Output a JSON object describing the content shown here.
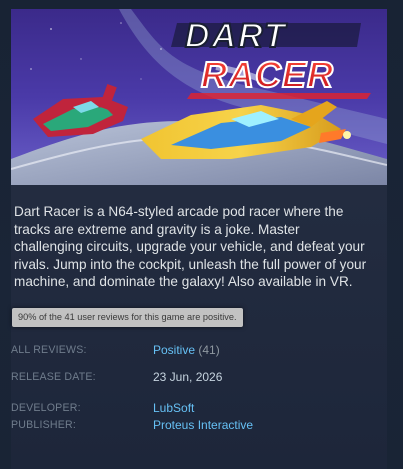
{
  "capsule": {
    "logo_word1": "DART",
    "logo_word2": "RACER",
    "alt": "Dart Racer header image"
  },
  "description": "Dart Racer is a N64-styled arcade pod racer where the tracks are extreme and gravity is a joke. Master challenging circuits, upgrade your vehicle, and defeat your rivals. Jump into the cockpit, unleash the full power of your machine, and dominate the galaxy! Also available in VR.",
  "tooltip": "90% of the 41 user reviews for this game are positive.",
  "info": {
    "reviews_label": "ALL REVIEWS:",
    "reviews_summary": "Positive",
    "reviews_count": "(41)",
    "release_label": "RELEASE DATE:",
    "release_date": "23 Jun, 2026",
    "developer_label": "DEVELOPER:",
    "developer": "LubSoft",
    "publisher_label": "PUBLISHER:",
    "publisher": "Proteus Interactive"
  },
  "colors": {
    "link": "#66c0f4",
    "label": "#6f7c8c",
    "background": "#1b2838",
    "logo_red": "#e4222b",
    "logo_white": "#ffffff"
  }
}
